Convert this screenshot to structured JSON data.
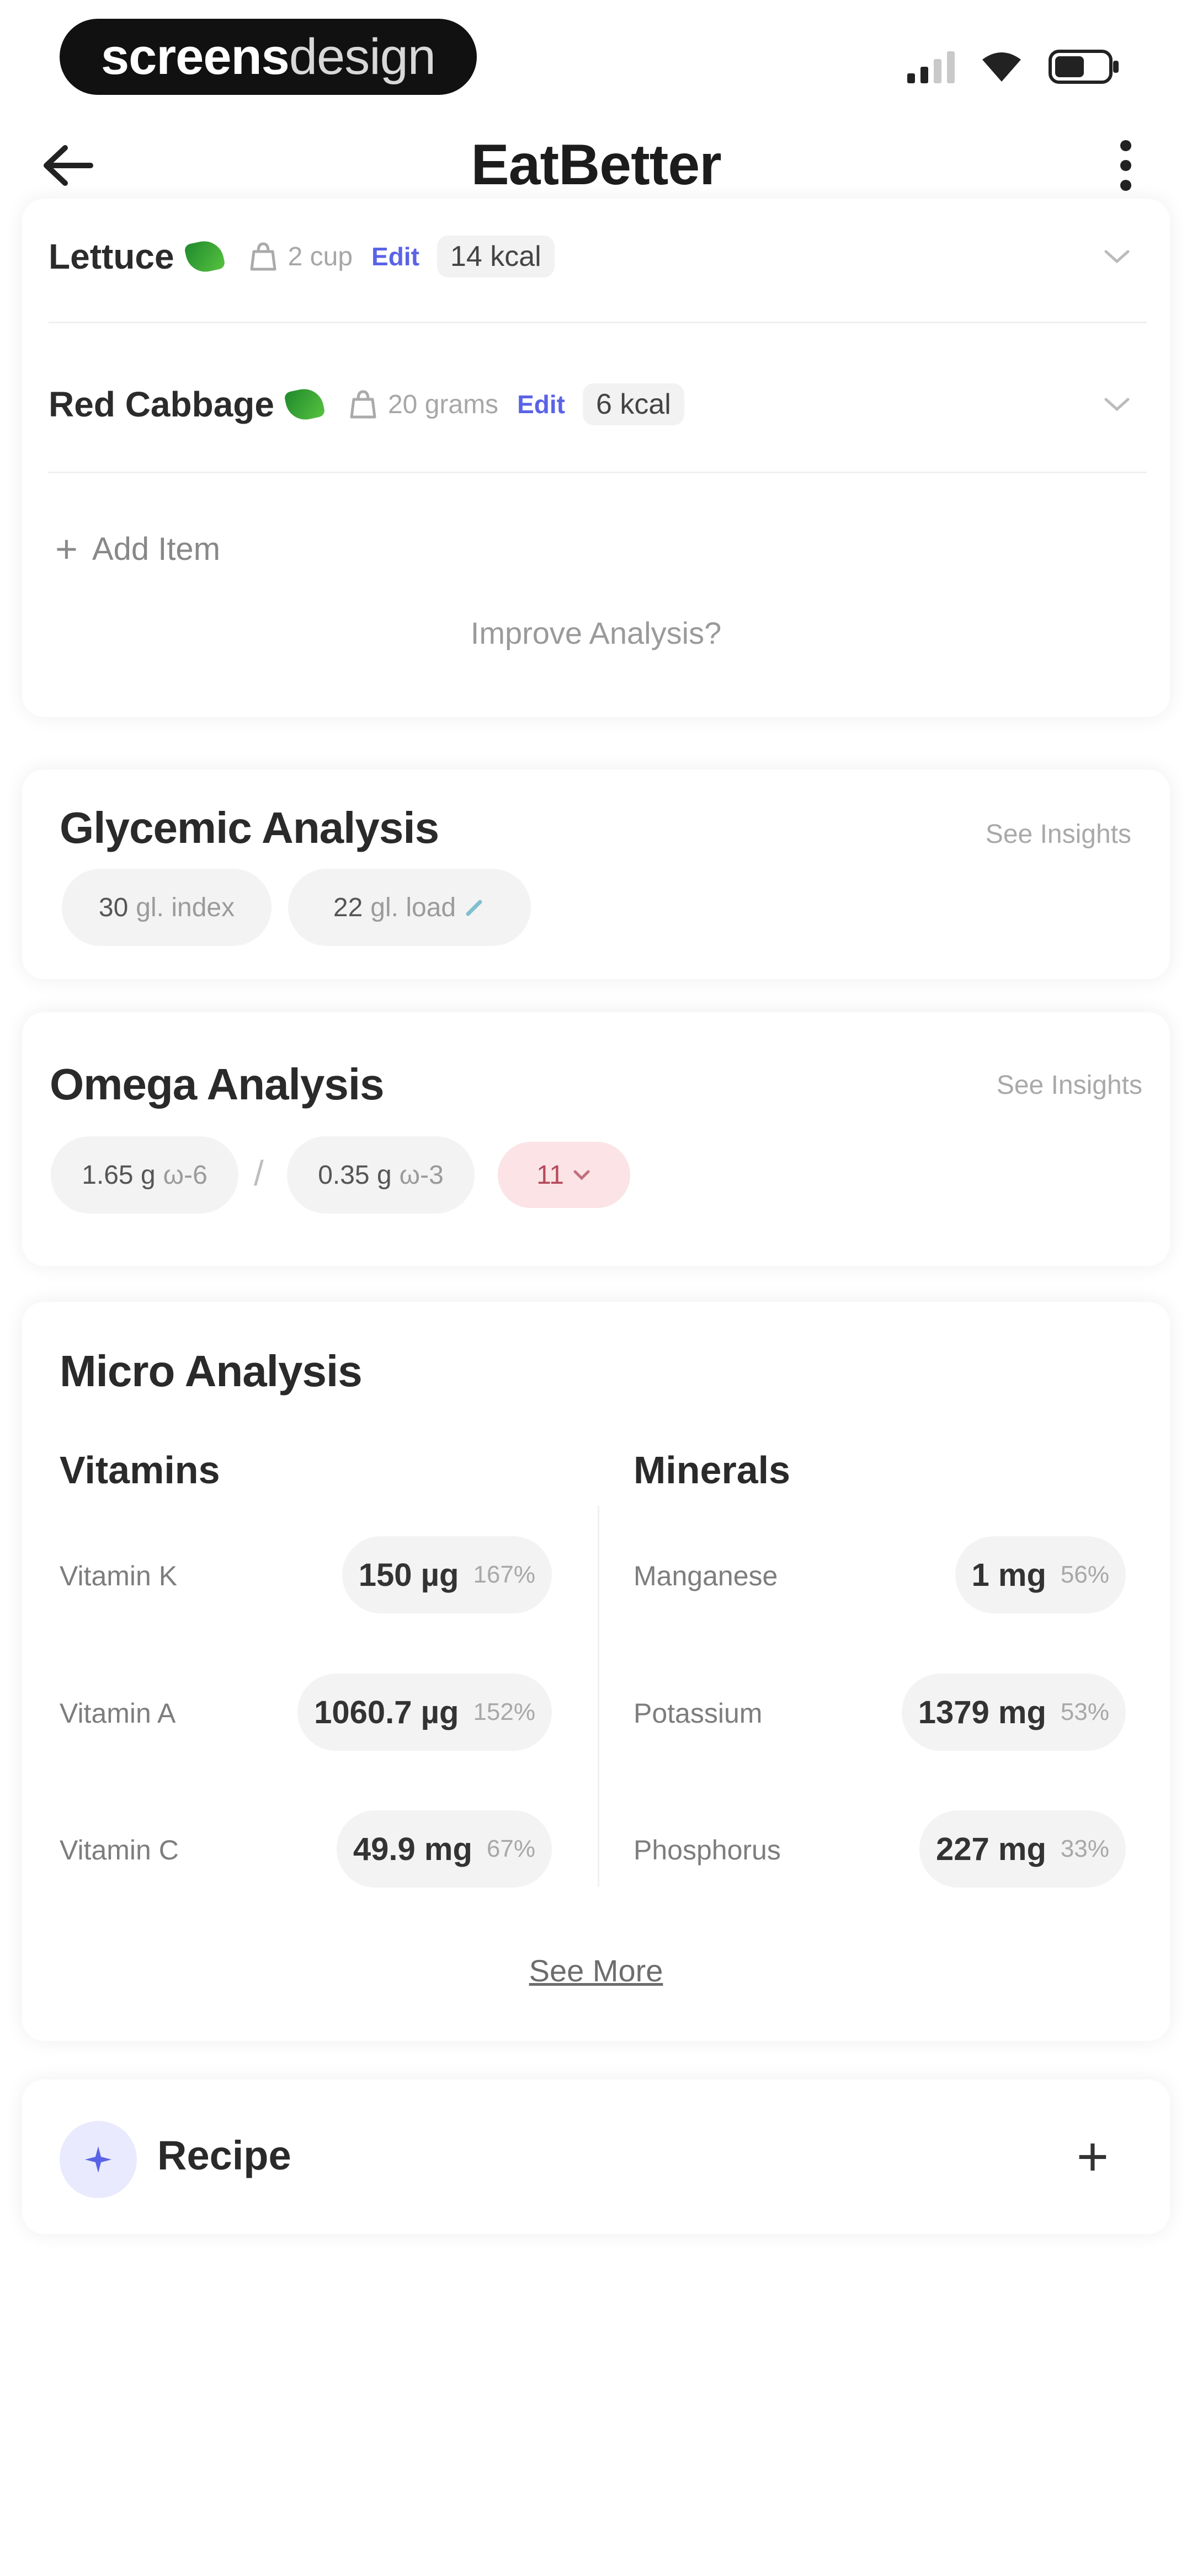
{
  "status_bar": {
    "brand_bold": "screens",
    "brand_light": "design"
  },
  "header": {
    "title": "EatBetter"
  },
  "food_items": [
    {
      "name": "Lettuce",
      "quantity": "2 cup",
      "edit_label": "Edit",
      "kcal": "14 kcal"
    },
    {
      "name": "Red Cabbage",
      "quantity": "20 grams",
      "edit_label": "Edit",
      "kcal": "6 kcal"
    }
  ],
  "ingredients_card": {
    "add_item_label": "Add Item",
    "improve_label": "Improve Analysis?"
  },
  "glycemic": {
    "title": "Glycemic Analysis",
    "insights_label": "See Insights",
    "index_value": "30",
    "index_unit": "gl. index",
    "load_value": "22",
    "load_unit": "gl. load"
  },
  "omega": {
    "title": "Omega Analysis",
    "insights_label": "See Insights",
    "omega6_value": "1.65 g",
    "omega6_label": "ω-6",
    "separator": "/",
    "omega3_value": "0.35 g",
    "omega3_label": "ω-3",
    "ratio": "11"
  },
  "micro": {
    "title": "Micro Analysis",
    "vitamins_title": "Vitamins",
    "minerals_title": "Minerals",
    "vitamins": [
      {
        "name": "Vitamin K",
        "value": "150 µg",
        "percent": "167%"
      },
      {
        "name": "Vitamin A",
        "value": "1060.7 µg",
        "percent": "152%"
      },
      {
        "name": "Vitamin C",
        "value": "49.9 mg",
        "percent": "67%"
      }
    ],
    "minerals": [
      {
        "name": "Manganese",
        "value": "1 mg",
        "percent": "56%"
      },
      {
        "name": "Potassium",
        "value": "1379 mg",
        "percent": "53%"
      },
      {
        "name": "Phosphorus",
        "value": "227 mg",
        "percent": "33%"
      }
    ],
    "see_more_label": "See More"
  },
  "recipe": {
    "title": "Recipe"
  },
  "colors": {
    "accent": "#5a63e6",
    "leaf": "#3aa534",
    "ratio_chip": "#fbe3e6"
  }
}
